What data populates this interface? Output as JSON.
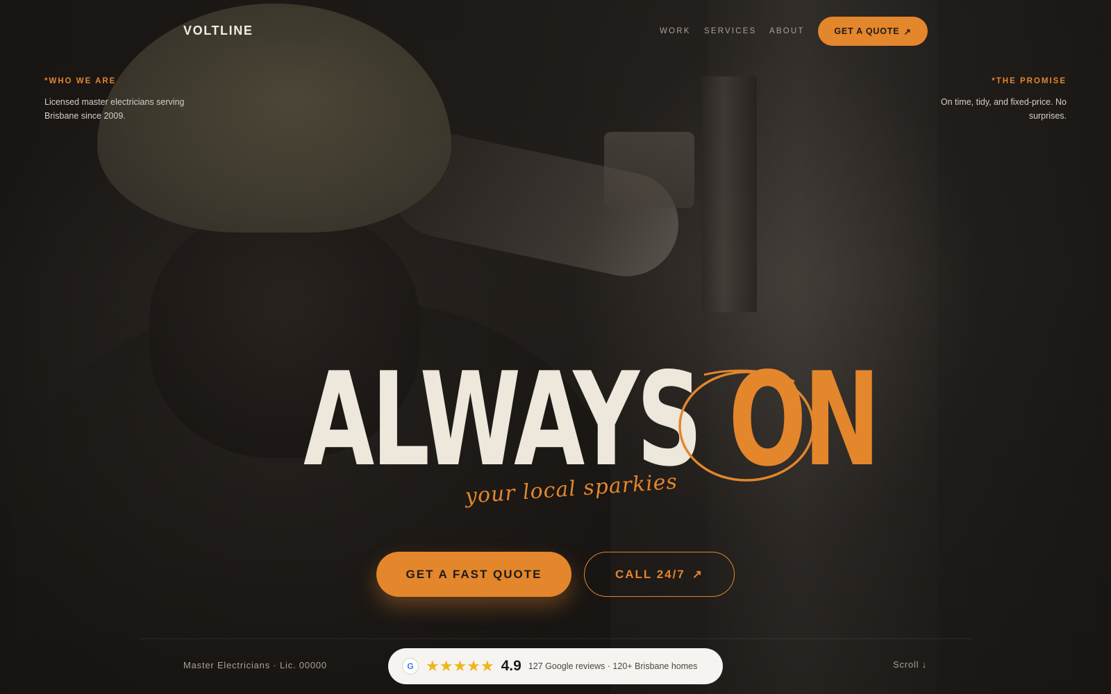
{
  "brand": {
    "logo": "VOLTLINE",
    "accent": "#e3862c"
  },
  "nav": {
    "links": [
      "WORK",
      "SERVICES",
      "ABOUT"
    ],
    "cta": "GET A QUOTE",
    "cta_icon": "arrow-up-right-icon"
  },
  "corners": {
    "left": {
      "eyebrow": "*WHO WE ARE",
      "text": "Licensed master electricians serving Brisbane since 2009."
    },
    "right": {
      "eyebrow": "*THE PROMISE",
      "text": "On time, tidy, and fixed-price. No surprises."
    }
  },
  "hero": {
    "headline_main": "ALWAYS",
    "headline_accent": "ON",
    "tagline": "your local sparkies",
    "primary_cta": "GET A FAST QUOTE",
    "secondary_cta": "CALL 24/7",
    "secondary_icon": "arrow-up-right-icon"
  },
  "footer": {
    "license": "Master Electricians · Lic. 00000",
    "reviews": {
      "icon": "google-icon",
      "icon_letter": "G",
      "stars": "★★★★★",
      "rating": "4.9",
      "text": "127 Google reviews · 120+ Brisbane homes"
    },
    "scroll": "Scroll ↓"
  }
}
